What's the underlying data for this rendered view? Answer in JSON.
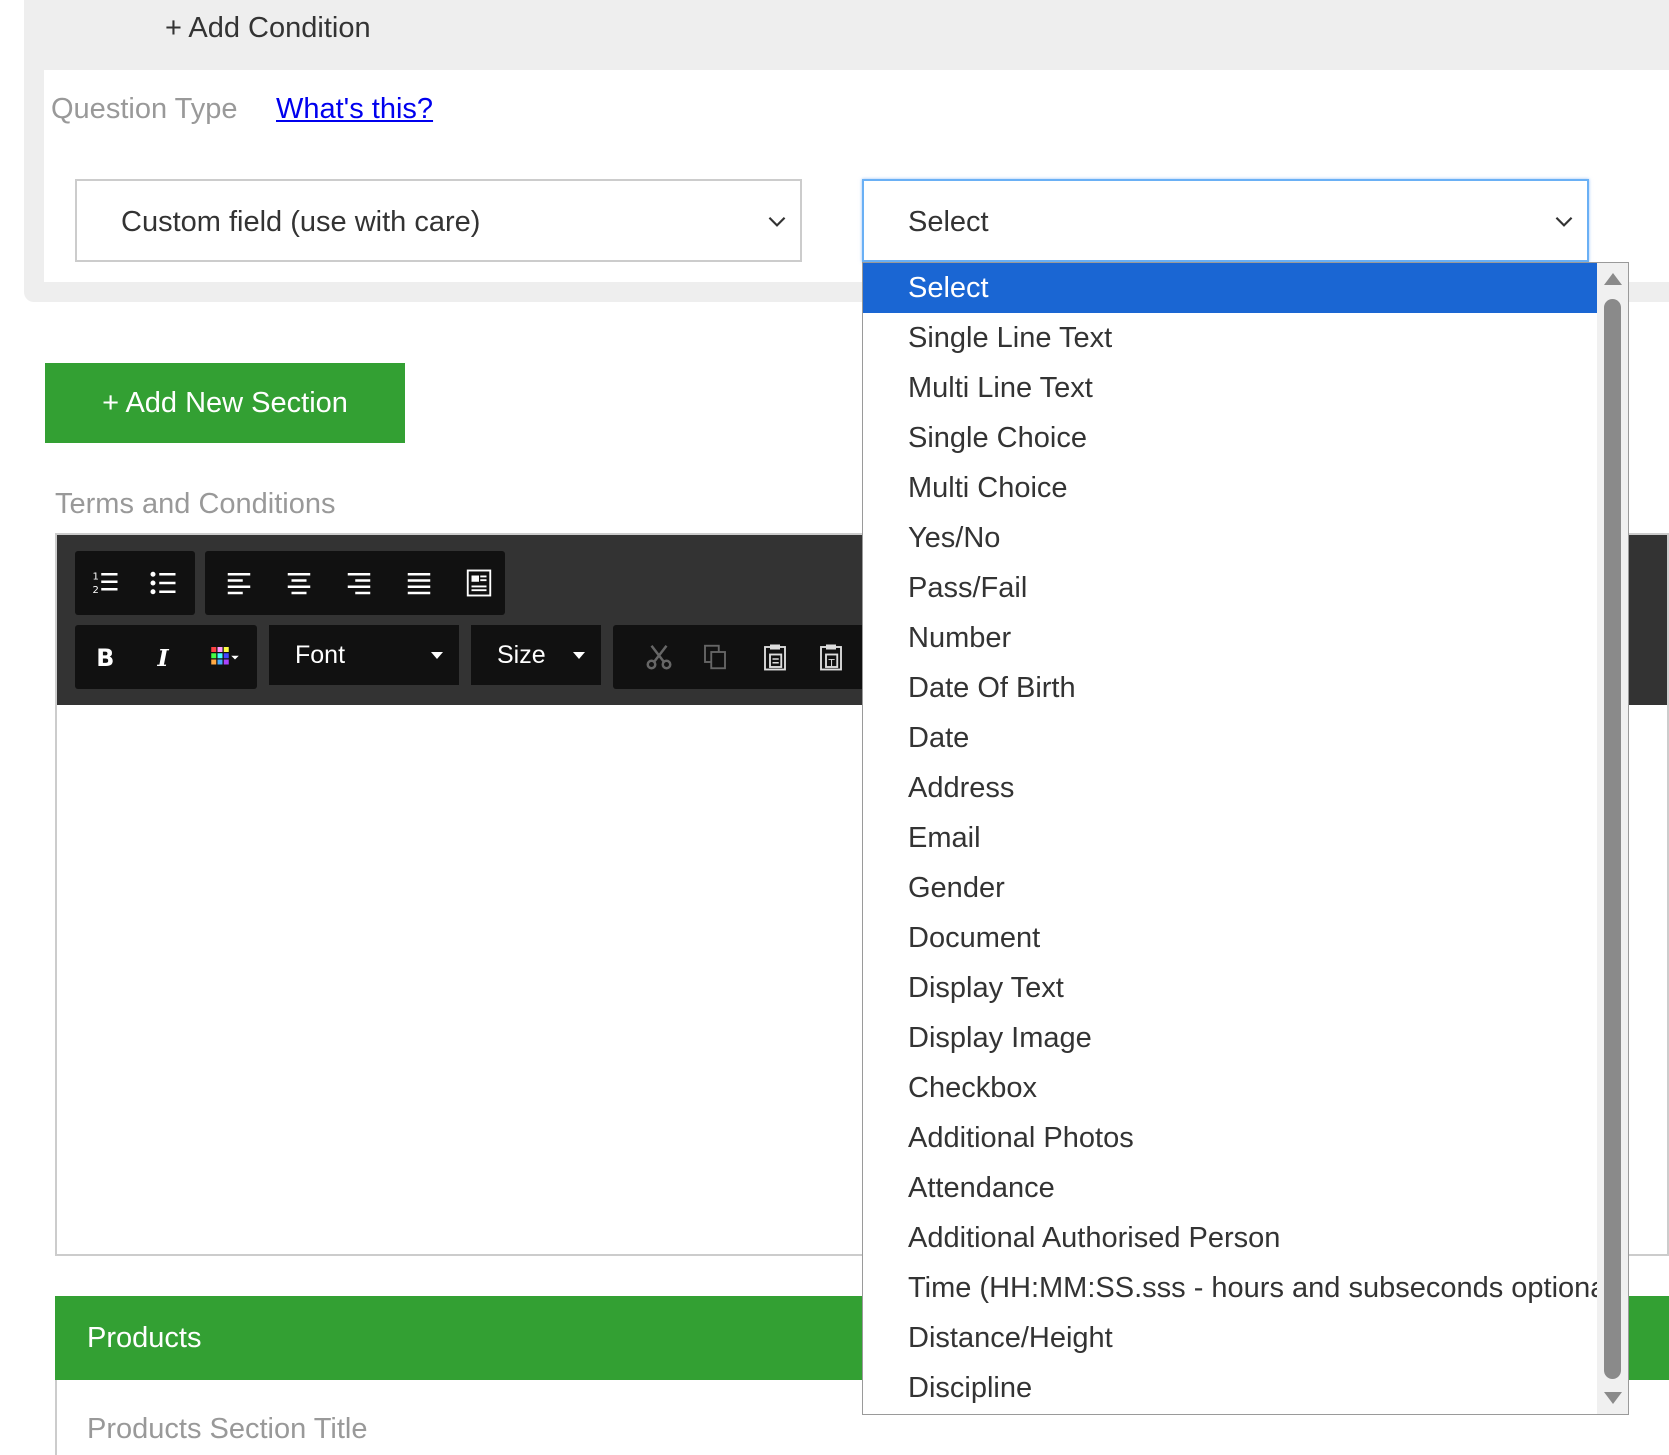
{
  "condition": {
    "add_condition_label": "+ Add Condition",
    "question_type_label": "Question Type",
    "whats_this_link": "What's this?",
    "field_select_value": "Custom field (use with care)",
    "type_select_value": "Select"
  },
  "add_section_button": "+ Add New Section",
  "terms_label": "Terms and Conditions",
  "editor": {
    "font_dropdown": "Font",
    "size_dropdown": "Size",
    "tools": [
      "ordered-list",
      "unordered-list",
      "align-left",
      "align-center",
      "align-right",
      "justify",
      "insert-template",
      "bold",
      "italic",
      "text-color",
      "cut",
      "copy",
      "paste",
      "paste-as-text"
    ]
  },
  "products": {
    "header": "Products",
    "section_title_placeholder": "Products Section Title"
  },
  "dropdown": {
    "selected_index": 0,
    "options": [
      "Select",
      "Single Line Text",
      "Multi Line Text",
      "Single Choice",
      "Multi Choice",
      "Yes/No",
      "Pass/Fail",
      "Number",
      "Date Of Birth",
      "Date",
      "Address",
      "Email",
      "Gender",
      "Document",
      "Display Text",
      "Display Image",
      "Checkbox",
      "Additional Photos",
      "Attendance",
      "Additional Authorised Person",
      "Time (HH:MM:SS.sss - hours and subseconds optional)",
      "Distance/Height",
      "Discipline"
    ]
  },
  "colors": {
    "green": "#33a033",
    "selected_blue": "#1a66d3",
    "toolbar_dark": "#333333",
    "link_blue": "#0000ee"
  }
}
